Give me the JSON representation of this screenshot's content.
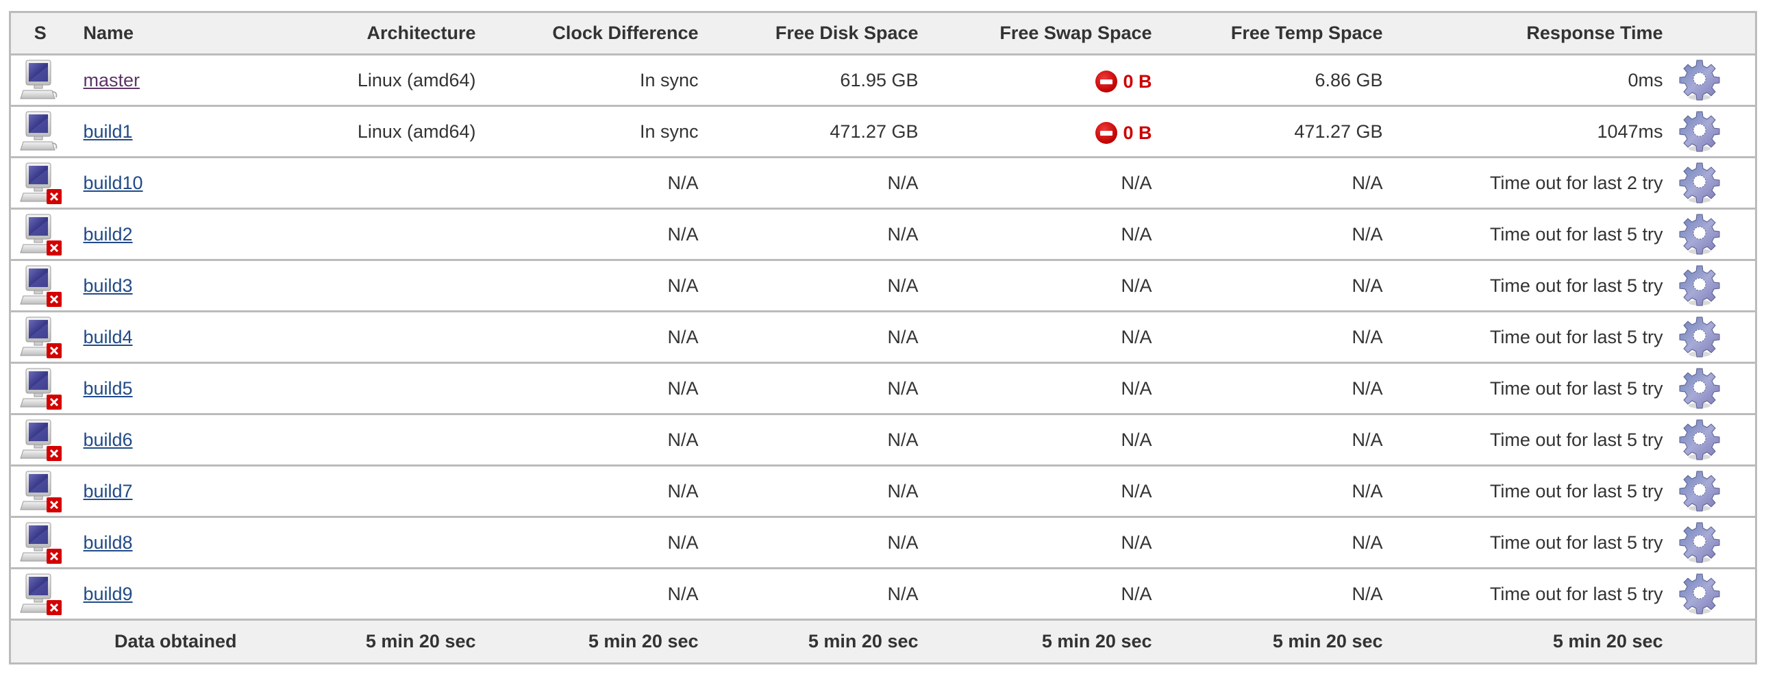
{
  "table": {
    "headers": {
      "status": "S",
      "name": "Name",
      "architecture": "Architecture",
      "clock_difference": "Clock Difference",
      "free_disk_space": "Free Disk Space",
      "free_swap_space": "Free Swap Space",
      "free_temp_space": "Free Temp Space",
      "response_time": "Response Time"
    },
    "rows": [
      {
        "name": "master",
        "visited": true,
        "offline": false,
        "architecture": "Linux (amd64)",
        "clock_difference": "In sync",
        "free_disk_space": "61.95 GB",
        "free_swap_space": "0 B",
        "swap_warning": true,
        "free_temp_space": "6.86 GB",
        "response_time": "0ms"
      },
      {
        "name": "build1",
        "visited": false,
        "offline": false,
        "architecture": "Linux (amd64)",
        "clock_difference": "In sync",
        "free_disk_space": "471.27 GB",
        "free_swap_space": "0 B",
        "swap_warning": true,
        "free_temp_space": "471.27 GB",
        "response_time": "1047ms"
      },
      {
        "name": "build10",
        "visited": false,
        "offline": true,
        "architecture": "",
        "clock_difference": "N/A",
        "free_disk_space": "N/A",
        "free_swap_space": "N/A",
        "swap_warning": false,
        "free_temp_space": "N/A",
        "response_time": "Time out for last 2 try"
      },
      {
        "name": "build2",
        "visited": false,
        "offline": true,
        "architecture": "",
        "clock_difference": "N/A",
        "free_disk_space": "N/A",
        "free_swap_space": "N/A",
        "swap_warning": false,
        "free_temp_space": "N/A",
        "response_time": "Time out for last 5 try"
      },
      {
        "name": "build3",
        "visited": false,
        "offline": true,
        "architecture": "",
        "clock_difference": "N/A",
        "free_disk_space": "N/A",
        "free_swap_space": "N/A",
        "swap_warning": false,
        "free_temp_space": "N/A",
        "response_time": "Time out for last 5 try"
      },
      {
        "name": "build4",
        "visited": false,
        "offline": true,
        "architecture": "",
        "clock_difference": "N/A",
        "free_disk_space": "N/A",
        "free_swap_space": "N/A",
        "swap_warning": false,
        "free_temp_space": "N/A",
        "response_time": "Time out for last 5 try"
      },
      {
        "name": "build5",
        "visited": false,
        "offline": true,
        "architecture": "",
        "clock_difference": "N/A",
        "free_disk_space": "N/A",
        "free_swap_space": "N/A",
        "swap_warning": false,
        "free_temp_space": "N/A",
        "response_time": "Time out for last 5 try"
      },
      {
        "name": "build6",
        "visited": false,
        "offline": true,
        "architecture": "",
        "clock_difference": "N/A",
        "free_disk_space": "N/A",
        "free_swap_space": "N/A",
        "swap_warning": false,
        "free_temp_space": "N/A",
        "response_time": "Time out for last 5 try"
      },
      {
        "name": "build7",
        "visited": false,
        "offline": true,
        "architecture": "",
        "clock_difference": "N/A",
        "free_disk_space": "N/A",
        "free_swap_space": "N/A",
        "swap_warning": false,
        "free_temp_space": "N/A",
        "response_time": "Time out for last 5 try"
      },
      {
        "name": "build8",
        "visited": false,
        "offline": true,
        "architecture": "",
        "clock_difference": "N/A",
        "free_disk_space": "N/A",
        "free_swap_space": "N/A",
        "swap_warning": false,
        "free_temp_space": "N/A",
        "response_time": "Time out for last 5 try"
      },
      {
        "name": "build9",
        "visited": false,
        "offline": true,
        "architecture": "",
        "clock_difference": "N/A",
        "free_disk_space": "N/A",
        "free_swap_space": "N/A",
        "swap_warning": false,
        "free_temp_space": "N/A",
        "response_time": "Time out for last 5 try"
      }
    ],
    "footer": {
      "label": "Data obtained",
      "architecture": "5 min 20 sec",
      "clock_difference": "5 min 20 sec",
      "free_disk_space": "5 min 20 sec",
      "free_swap_space": "5 min 20 sec",
      "free_temp_space": "5 min 20 sec",
      "response_time": "5 min 20 sec"
    },
    "icons": {
      "status_online": "computer-icon",
      "status_offline": "computer-offline-icon",
      "swap_warning": "stop-icon",
      "configure": "gear-icon"
    },
    "colors": {
      "link": "#204a87",
      "link_visited": "#5c3566",
      "warning": "#cc0000",
      "header_bg": "#f0f0f0",
      "border": "#bbbbbb"
    }
  }
}
